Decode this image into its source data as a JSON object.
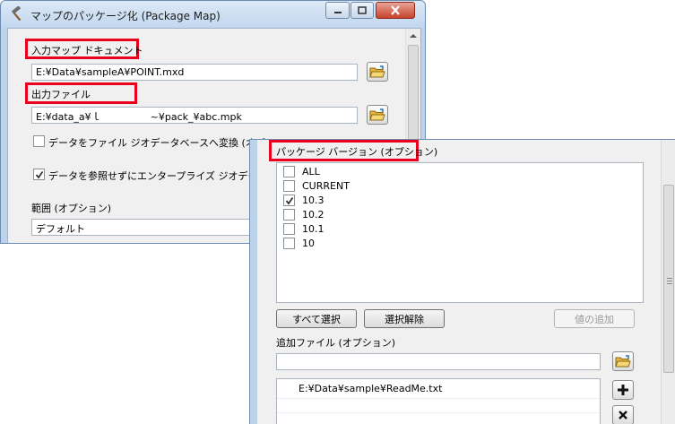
{
  "window1": {
    "title": "マップのパッケージ化 (Package Map)",
    "input_map_doc": {
      "label": "入力マップ ドキュメント",
      "value": "E:¥Data¥sampleA¥POINT.mxd"
    },
    "output_file": {
      "label": "出力ファイル",
      "value": "E:¥data_a¥ｌ　　　　　~¥pack_¥abc.mpk"
    },
    "convert_to_fgdb": {
      "label": "データをファイル ジオデータベースへ変換 (オプション)",
      "checked": false
    },
    "no_ref_enterprise": {
      "label": "データを参照せずにエンタープライズ ジオデータベー",
      "checked": true
    },
    "extent": {
      "label": "範囲 (オプション)",
      "value": "デフォルト"
    }
  },
  "window2": {
    "package_version_label": "パッケージ バージョン (オプション)",
    "versions": [
      {
        "label": "ALL",
        "checked": false
      },
      {
        "label": "CURRENT",
        "checked": false
      },
      {
        "label": "10.3",
        "checked": true
      },
      {
        "label": "10.2",
        "checked": false
      },
      {
        "label": "10.1",
        "checked": false
      },
      {
        "label": "10",
        "checked": false
      }
    ],
    "select_all_label": "すべて選択",
    "clear_selection_label": "選択解除",
    "add_value_label": "値の追加",
    "additional_files_label": "追加ファイル (オプション)",
    "additional_files_input": "",
    "additional_files": [
      "E:¥Data¥sample¥ReadMe.txt"
    ]
  },
  "colors": {
    "highlight": "#e8001c",
    "titlebar": "#c2d6ee",
    "client": "#f0f0f0"
  }
}
